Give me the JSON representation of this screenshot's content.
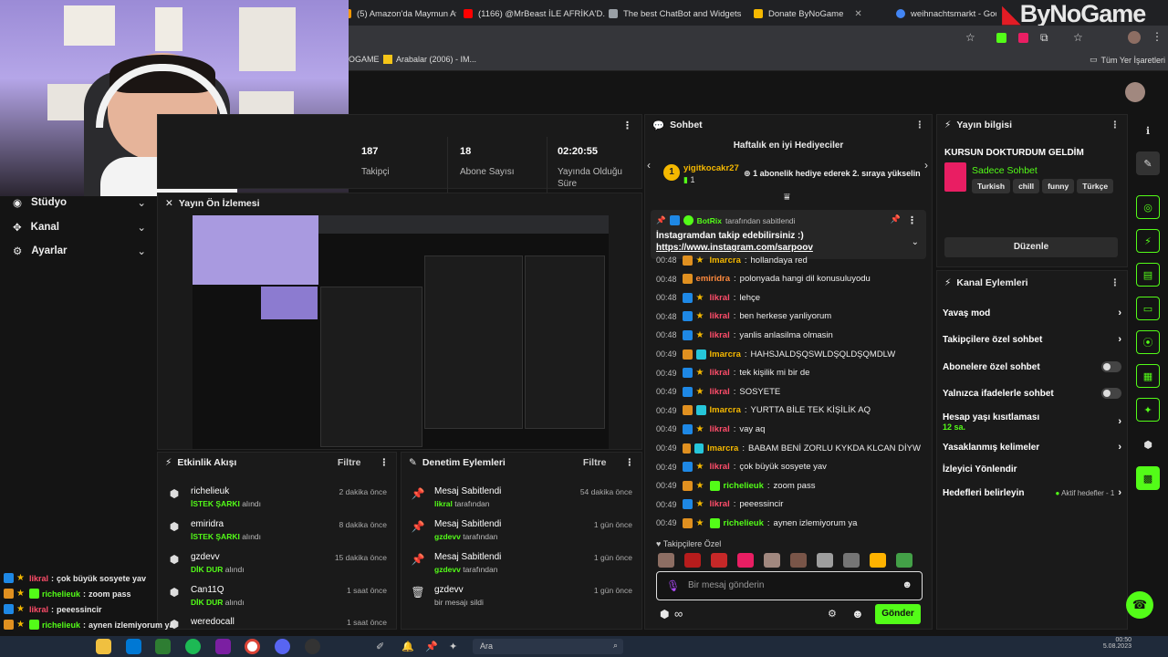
{
  "browser": {
    "tabs": [
      {
        "label": "(5) Amazon'da Maymun Av...",
        "color": "#ff9900"
      },
      {
        "label": "(1166) @MrBeast İLE AFRİKA'D...",
        "color": "#ff0000"
      },
      {
        "label": "The best ChatBot and Widgets",
        "color": "#9aa0a6"
      },
      {
        "label": "Donate ByNoGame",
        "color": "#f5b800"
      },
      {
        "label": "weihnachtsmarkt - Goo...",
        "color": "#4285f4"
      }
    ],
    "bookmarks": [
      "OGAME",
      "Arabalar (2006) - IM..."
    ],
    "bookmarks_right": "Tüm Yer İşaretleri",
    "watermark": "ByNoGame"
  },
  "stats": [
    {
      "value": "187",
      "label": "Takipçi"
    },
    {
      "value": "18",
      "label": "Abone Sayısı"
    },
    {
      "value": "02:20:55",
      "label": "Yayında Olduğu Süre"
    }
  ],
  "nav": [
    {
      "label": "Stüdyo",
      "icon": "studio-icon"
    },
    {
      "label": "Kanal",
      "icon": "channel-icon"
    },
    {
      "label": "Ayarlar",
      "icon": "gear-icon"
    }
  ],
  "preview": {
    "title": "Yayın Ön İzlemesi"
  },
  "activity": {
    "title": "Etkinlik Akışı",
    "filter": "Filtre",
    "items": [
      {
        "user": "richelieuk",
        "action": "İSTEK ŞARKI",
        "suffix": "alındı",
        "time": "2 dakika önce"
      },
      {
        "user": "emiridra",
        "action": "İSTEK ŞARKI",
        "suffix": "alındı",
        "time": "8 dakika önce"
      },
      {
        "user": "gzdevv",
        "action": "DİK DUR",
        "suffix": "alındı",
        "time": "15 dakika önce"
      },
      {
        "user": "Can11Q",
        "action": "DİK DUR",
        "suffix": "alındı",
        "time": "1 saat önce"
      },
      {
        "user": "weredocall",
        "action": "",
        "suffix": "",
        "time": "1 saat önce"
      }
    ]
  },
  "moderation": {
    "title": "Denetim Eylemleri",
    "filter": "Filtre",
    "items": [
      {
        "title": "Mesaj Sabitlendi",
        "user": "likral",
        "suffix": "tarafından",
        "time": "54 dakika önce",
        "icon": "pin-icon"
      },
      {
        "title": "Mesaj Sabitlendi",
        "user": "gzdevv",
        "suffix": "tarafından",
        "time": "1 gün önce",
        "icon": "pin-icon"
      },
      {
        "title": "Mesaj Sabitlendi",
        "user": "gzdevv",
        "suffix": "tarafından",
        "time": "1 gün önce",
        "icon": "pin-icon"
      },
      {
        "title": "gzdevv",
        "user": "",
        "suffix": "bir mesajı sildi",
        "time": "1 gün önce",
        "icon": "trash-icon"
      }
    ]
  },
  "chat": {
    "title": "Sohbet",
    "gifters_title": "Haftalık en iyi Hediyeciler",
    "gifter_rank": "1",
    "gifter_name": "yigitkocakr27",
    "gifter_count": "1",
    "gifter_note": "1 abonelik hediye ederek 2. sıraya yükselin",
    "pinned_by_user": "BotRix",
    "pinned_by_suffix": "tarafından sabitlendi",
    "pinned_text": "İnstagramdan takip edebilirsiniz :)",
    "pinned_link": "https://www.instagram.com/sarpoov",
    "messages": [
      {
        "time": "00:48",
        "badges": [
          "b4",
          "b2"
        ],
        "user": "Imarcra",
        "color": "u-gold",
        "text": "hollandaya red"
      },
      {
        "time": "00:48",
        "badges": [
          "b4"
        ],
        "user": "emiridra",
        "color": "u-orange",
        "text": "polonyada hangi dil konusuluyodu"
      },
      {
        "time": "00:48",
        "badges": [
          "b1",
          "b2"
        ],
        "user": "likral",
        "color": "u-red",
        "text": "lehçe"
      },
      {
        "time": "00:48",
        "badges": [
          "b1",
          "b2"
        ],
        "user": "likral",
        "color": "u-red",
        "text": "ben herkese yanliyorum"
      },
      {
        "time": "00:48",
        "badges": [
          "b1",
          "b2"
        ],
        "user": "likral",
        "color": "u-red",
        "text": "yanlis anlasilma olmasin"
      },
      {
        "time": "00:49",
        "badges": [
          "b4",
          "b3"
        ],
        "user": "Imarcra",
        "color": "u-gold",
        "text": "HAHSJALDŞQSWLDŞQLDŞQMDLW"
      },
      {
        "time": "00:49",
        "badges": [
          "b1",
          "b2"
        ],
        "user": "likral",
        "color": "u-red",
        "text": "tek kişilik mi bir de"
      },
      {
        "time": "00:49",
        "badges": [
          "b1",
          "b2"
        ],
        "user": "likral",
        "color": "u-red",
        "text": "SOSYETE"
      },
      {
        "time": "00:49",
        "badges": [
          "b4",
          "b3"
        ],
        "user": "Imarcra",
        "color": "u-gold",
        "text": "YURTTA BİLE TEK KİŞİLİK AQ"
      },
      {
        "time": "00:49",
        "badges": [
          "b1",
          "b2"
        ],
        "user": "likral",
        "color": "u-red",
        "text": "vay aq"
      },
      {
        "time": "00:49",
        "badges": [
          "b4",
          "b3"
        ],
        "user": "Imarcra",
        "color": "u-gold",
        "text": "BABAM BENİ ZORLU KYKDA KLCAN DİYW"
      },
      {
        "time": "00:49",
        "badges": [
          "b1",
          "b2"
        ],
        "user": "likral",
        "color": "u-red",
        "text": "çok büyük sosyete yav"
      },
      {
        "time": "00:49",
        "badges": [
          "b4",
          "b2",
          "b5"
        ],
        "user": "richelieuk",
        "color": "u-green",
        "text": "zoom pass"
      },
      {
        "time": "00:49",
        "badges": [
          "b1",
          "b2"
        ],
        "user": "likral",
        "color": "u-red",
        "text": "peeessincir"
      },
      {
        "time": "00:49",
        "badges": [
          "b4",
          "b2",
          "b5"
        ],
        "user": "richelieuk",
        "color": "u-green",
        "text": "aynen izlemiyorum ya"
      }
    ],
    "followers_label": "Takipçilere Özel",
    "input_placeholder": "Bir mesaj gönderin",
    "send_label": "Gönder"
  },
  "stream_info": {
    "title": "Yayın bilgisi",
    "stream_title": "KURSUN DOKTURDUM GELDİM",
    "category": "Sadece Sohbet",
    "tags": [
      "Turkish",
      "chill",
      "funny",
      "Türkçe"
    ],
    "edit_label": "Düzenle"
  },
  "channel_actions": {
    "title": "Kanal Eylemleri",
    "rows": [
      {
        "label": "Yavaş mod",
        "kind": "chev"
      },
      {
        "label": "Takipçilere özel sohbet",
        "kind": "chev"
      },
      {
        "label": "Abonelere özel sohbet",
        "kind": "toggle"
      },
      {
        "label": "Yalnızca ifadelerle sohbet",
        "kind": "toggle"
      },
      {
        "label": "Hesap yaşı kısıtlaması",
        "sub": "12 sa.",
        "kind": "chev"
      },
      {
        "label": "Yasaklanmış kelimeler",
        "kind": "chev"
      },
      {
        "label": "İzleyici Yönlendir",
        "kind": "none"
      },
      {
        "label": "Hedefleri belirleyin",
        "kind": "goal",
        "goal": "Aktif hedefler - 1"
      }
    ]
  },
  "overlay_chat": [
    {
      "user": "likral",
      "color": "#ff4d6a",
      "text": "çok büyük sosyete yav"
    },
    {
      "user": "richelieuk",
      "color": "#53fc18",
      "text": "zoom pass"
    },
    {
      "user": "likral",
      "color": "#ff4d6a",
      "text": "peeessincir"
    },
    {
      "user": "richelieuk",
      "color": "#53fc18",
      "text": "aynen izlemiyorum ya"
    }
  ],
  "taskbar": {
    "search_placeholder": "Ara",
    "time": "00:50",
    "date": "5.08.2023"
  },
  "colors": {
    "accent": "#53fc18",
    "bg": "#141414",
    "panel": "#1a1a1a"
  }
}
